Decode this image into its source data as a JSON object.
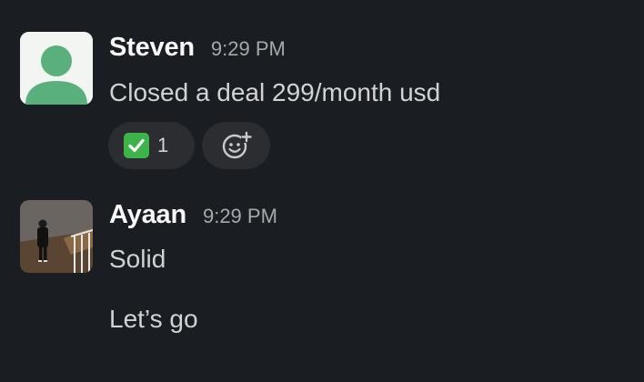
{
  "messages": [
    {
      "author": "Steven",
      "time": "9:29 PM",
      "avatar": "default-user-avatar",
      "lines": [
        "Closed a deal 299/month usd"
      ],
      "reactions": [
        {
          "emoji": "white-check-mark-icon",
          "count": "1"
        }
      ],
      "add_reaction_icon": "add-reaction-icon"
    },
    {
      "author": "Ayaan",
      "time": "9:29 PM",
      "avatar": "user-photo-avatar",
      "lines": [
        "Solid",
        "Let’s go"
      ]
    }
  ],
  "colors": {
    "background": "#1a1d21",
    "author": "#f8f8f8",
    "text": "#d1d2d3",
    "timestamp": "#a7a8aa",
    "reaction_pill": "#2b2d31",
    "check_green": "#3cb44a",
    "default_avatar_green": "#5ab07c"
  }
}
